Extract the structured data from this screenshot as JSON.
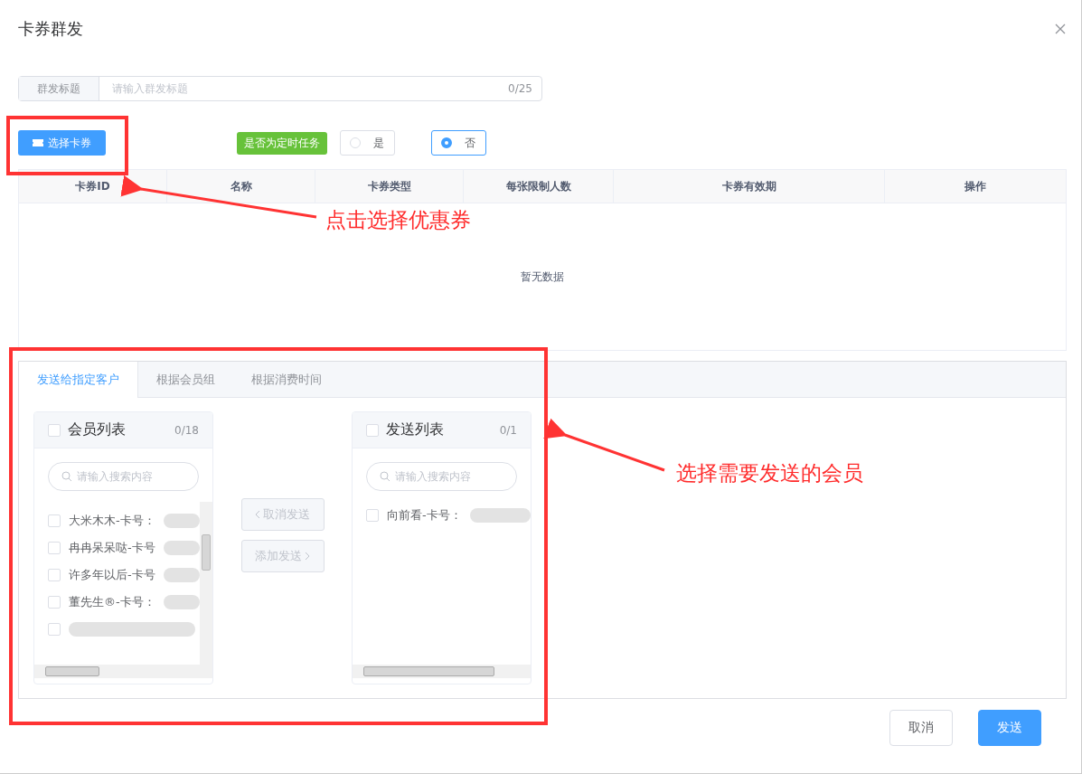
{
  "dialog": {
    "title": "卡券群发"
  },
  "title_field": {
    "label": "群发标题",
    "placeholder": "请输入群发标题",
    "counter": "0/25"
  },
  "select_coupon_button": {
    "label": "选择卡券"
  },
  "scheduled": {
    "tag": "是否为定时任务",
    "options": [
      {
        "label": "是",
        "selected": false
      },
      {
        "label": "否",
        "selected": true
      }
    ]
  },
  "table": {
    "columns": [
      "卡券ID",
      "名称",
      "卡券类型",
      "每张限制人数",
      "卡券有效期",
      "操作"
    ],
    "empty_text": "暂无数据"
  },
  "tabs": [
    {
      "label": "发送给指定客户",
      "selected": true
    },
    {
      "label": "根据会员组",
      "selected": false
    },
    {
      "label": "根据消费时间",
      "selected": false
    }
  ],
  "member_list": {
    "title": "会员列表",
    "counter": "0/18",
    "checked": false,
    "search_placeholder": "请输入搜索内容",
    "items": [
      {
        "kind": "member",
        "label": "大米木木-卡号：",
        "checked": false
      },
      {
        "kind": "member",
        "label": "冉冉呆呆哒-卡号",
        "checked": false
      },
      {
        "kind": "member",
        "label": "许多年以后-卡号",
        "checked": false
      },
      {
        "kind": "member",
        "label": "董先生®-卡号：",
        "checked": false
      },
      {
        "kind": "redacted",
        "checked": false
      }
    ]
  },
  "transfer_buttons": [
    {
      "label": "取消发送",
      "kind": "back",
      "disabled": true
    },
    {
      "label": "添加发送",
      "kind": "forward",
      "disabled": true
    }
  ],
  "send_list": {
    "title": "发送列表",
    "counter": "0/1",
    "checked": false,
    "search_placeholder": "请输入搜索内容",
    "items": [
      {
        "kind": "member",
        "label": "向前看-卡号：",
        "checked": false
      }
    ]
  },
  "footer_buttons": [
    {
      "label": "取消",
      "kind": "default"
    },
    {
      "label": "发送",
      "kind": "primary"
    }
  ],
  "annotations": [
    {
      "text": "点击选择优惠券"
    },
    {
      "text": "选择需要发送的会员"
    }
  ]
}
